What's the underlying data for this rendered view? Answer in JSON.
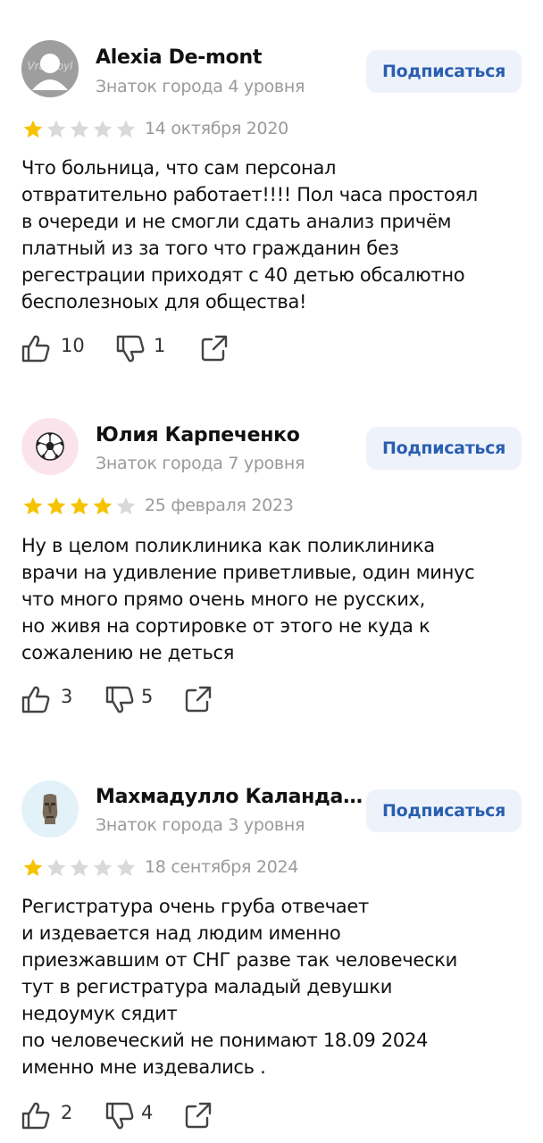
{
  "subscribe_label": "Подписаться",
  "colors": {
    "star_filled": "#f6c300",
    "star_empty": "#d9d9d9",
    "accent": "#2a5eb0",
    "button_bg": "#eef3fb"
  },
  "reviews": [
    {
      "author": "Alexia De-mont",
      "level": "Знаток города 4 уровня",
      "rating": 1,
      "date": "14 октября 2020",
      "avatar_watermark": "Vrussoyl",
      "text": "Что больница, что сам персонал\nотвратительно работает!!!! Пол часа простоял\nв очереди и не смогли сдать анализ причём\nплатный из за того что гражданин без\nрегестрации приходят с 40 детью обсалютно\nбесполезноых для общества!",
      "likes": "10",
      "dislikes": "1"
    },
    {
      "author": "Юлия Карпеченко",
      "level": "Знаток города 7 уровня",
      "rating": 4,
      "date": "25 февраля 2023",
      "avatar_icon": "soccer-ball-icon",
      "text": "Ну в целом поликлиника как поликлиника\nврачи на удивление приветливые, один минус\nчто много прямо очень много не русских,\nно живя на сортировке от этого не куда к\nсожалению не деться",
      "likes": "3",
      "dislikes": "5"
    },
    {
      "author": "Махмадулло Каландар...",
      "level": "Знаток города 3 уровня",
      "rating": 1,
      "date": "18 сентября 2024",
      "avatar_icon": "moai-icon",
      "text": "Регистратура очень груба отвечает\nи издевается над людим именно\nприезжавшим от СНГ разве так человечески\nтут в регистратура маладый девушки\nнедоумук сядит\nпо человеческий не понимают 18.09 2024\nименно мне издевались .",
      "likes": "2",
      "dislikes": "4"
    }
  ]
}
